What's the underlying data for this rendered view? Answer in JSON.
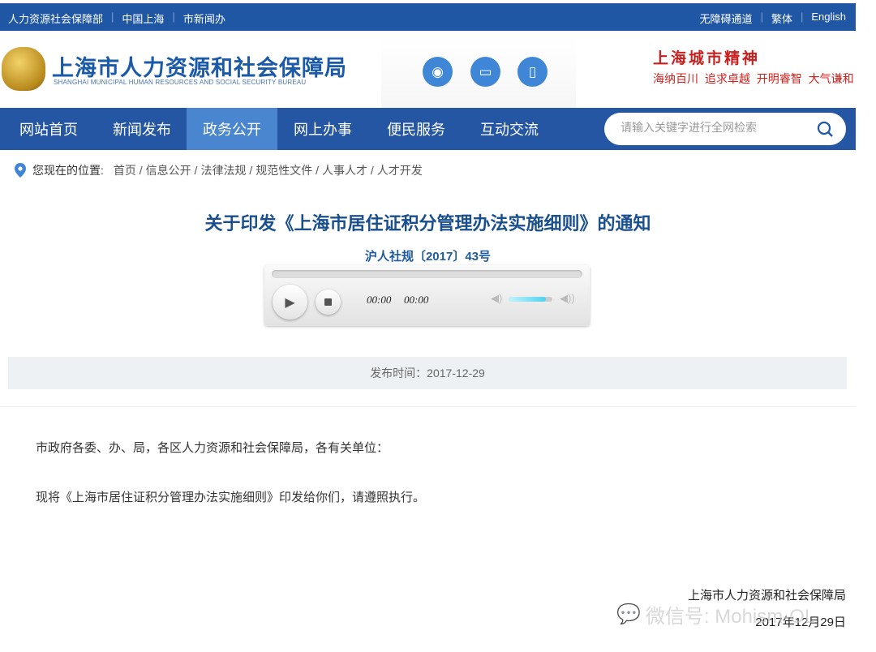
{
  "topbar": {
    "left": [
      "人力资源社会保障部",
      "中国上海",
      "市新闻办"
    ],
    "right": [
      "无障碍通道",
      "繁体",
      "English"
    ]
  },
  "header": {
    "logo_cn": "上海市人力资源和社会保障局",
    "logo_en": "SHANGHAI MUNICIPAL HUMAN RESOURCES AND SOCIAL SECURITY BUREAU",
    "icons": [
      "weibo-icon",
      "desktop-icon",
      "mobile-icon"
    ],
    "spirit_title": "上海城市精神",
    "spirit_slogan": "海纳百川 追求卓越 开明睿智 大气谦和"
  },
  "nav": {
    "items": [
      {
        "label": "网站首页"
      },
      {
        "label": "新闻发布"
      },
      {
        "label": "政务公开",
        "active": true
      },
      {
        "label": "网上办事"
      },
      {
        "label": "便民服务"
      },
      {
        "label": "互动交流"
      }
    ],
    "search_placeholder": "请输入关键字进行全网检索"
  },
  "breadcrumb": {
    "label": "您现在的位置:",
    "items": [
      "首页 /",
      "信息公开 /",
      "法律法规 /",
      "规范性文件 /",
      "人事人才 /",
      "人才开发"
    ]
  },
  "article": {
    "title": "关于印发《上海市居住证积分管理办法实施细则》的通知",
    "doc_no": "沪人社规〔2017〕43号",
    "publish": "发布时间：2017-12-29",
    "paragraphs": [
      "市政府各委、办、局，各区人力资源和社会保障局，各有关单位：",
      "现将《上海市居住证积分管理办法实施细则》印发给你们，请遵照执行。"
    ],
    "signature_org": "上海市人力资源和社会保障局",
    "signature_date": "2017年12月29日"
  },
  "player": {
    "current": "00:00",
    "duration": "00:00",
    "progress": 0,
    "volume": 0.85
  },
  "watermark": "微信号: Mohism-OL",
  "colors": {
    "primary": "#1f57a5",
    "nav_active": "#4a86cf",
    "title": "#1a4f8e",
    "spirit": "#c8201e"
  }
}
